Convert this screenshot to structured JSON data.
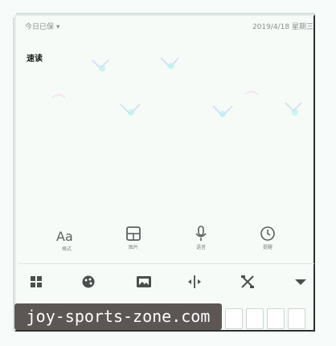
{
  "status": {
    "left": "今日已保 ▾",
    "right": "2019/4/18 星期三"
  },
  "note": {
    "title": "速读"
  },
  "tools": [
    {
      "label": "格式",
      "icon": "text-format-icon"
    },
    {
      "label": "图片",
      "icon": "image-layout-icon"
    },
    {
      "label": "语音",
      "icon": "microphone-icon"
    },
    {
      "label": "提醒",
      "icon": "clock-icon"
    }
  ],
  "toolbar": [
    {
      "icon": "grid-icon"
    },
    {
      "icon": "palette-icon"
    },
    {
      "icon": "image-icon"
    },
    {
      "icon": "split-icon"
    },
    {
      "icon": "scissors-icon"
    },
    {
      "icon": "chevron-down-icon"
    }
  ],
  "watermark": {
    "text": "joy-sports-zone.com"
  },
  "colors": {
    "background": "#f7fbf9",
    "banner": "#5c5754",
    "icon": "#4a4f4d"
  }
}
